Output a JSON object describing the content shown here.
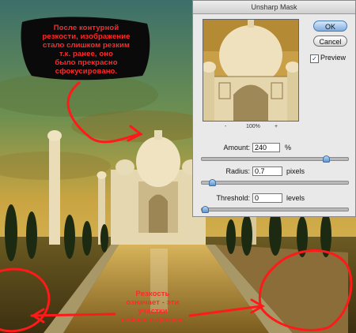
{
  "dialog": {
    "title": "Unsharp Mask",
    "ok_label": "OK",
    "cancel_label": "Cancel",
    "preview_label": "Preview",
    "preview_checked": true,
    "zoom": {
      "minus": "-",
      "level": "100%",
      "plus": "+"
    },
    "amount": {
      "label": "Amount:",
      "value": "240",
      "unit": "%",
      "slider_fraction": 0.87
    },
    "radius": {
      "label": "Radius:",
      "value": "0.7",
      "unit": "pixels",
      "slider_fraction": 0.05
    },
    "threshold": {
      "label": "Threshold:",
      "value": "0",
      "unit": "levels",
      "slider_fraction": 0.0
    }
  },
  "annotations": {
    "top": [
      "После контурной",
      "резкости, изображение",
      "стало слишком резким",
      "т.к. ранее, оно",
      "было прекрасно сфокусировано."
    ],
    "bottom": [
      "Резкость",
      "означает - эти",
      "участки",
      "сейчас в фокусе"
    ]
  },
  "colors": {
    "annotation": "#ff2a2a",
    "slider_thumb": "#5d95d2",
    "ok_button": "#7faee0"
  }
}
